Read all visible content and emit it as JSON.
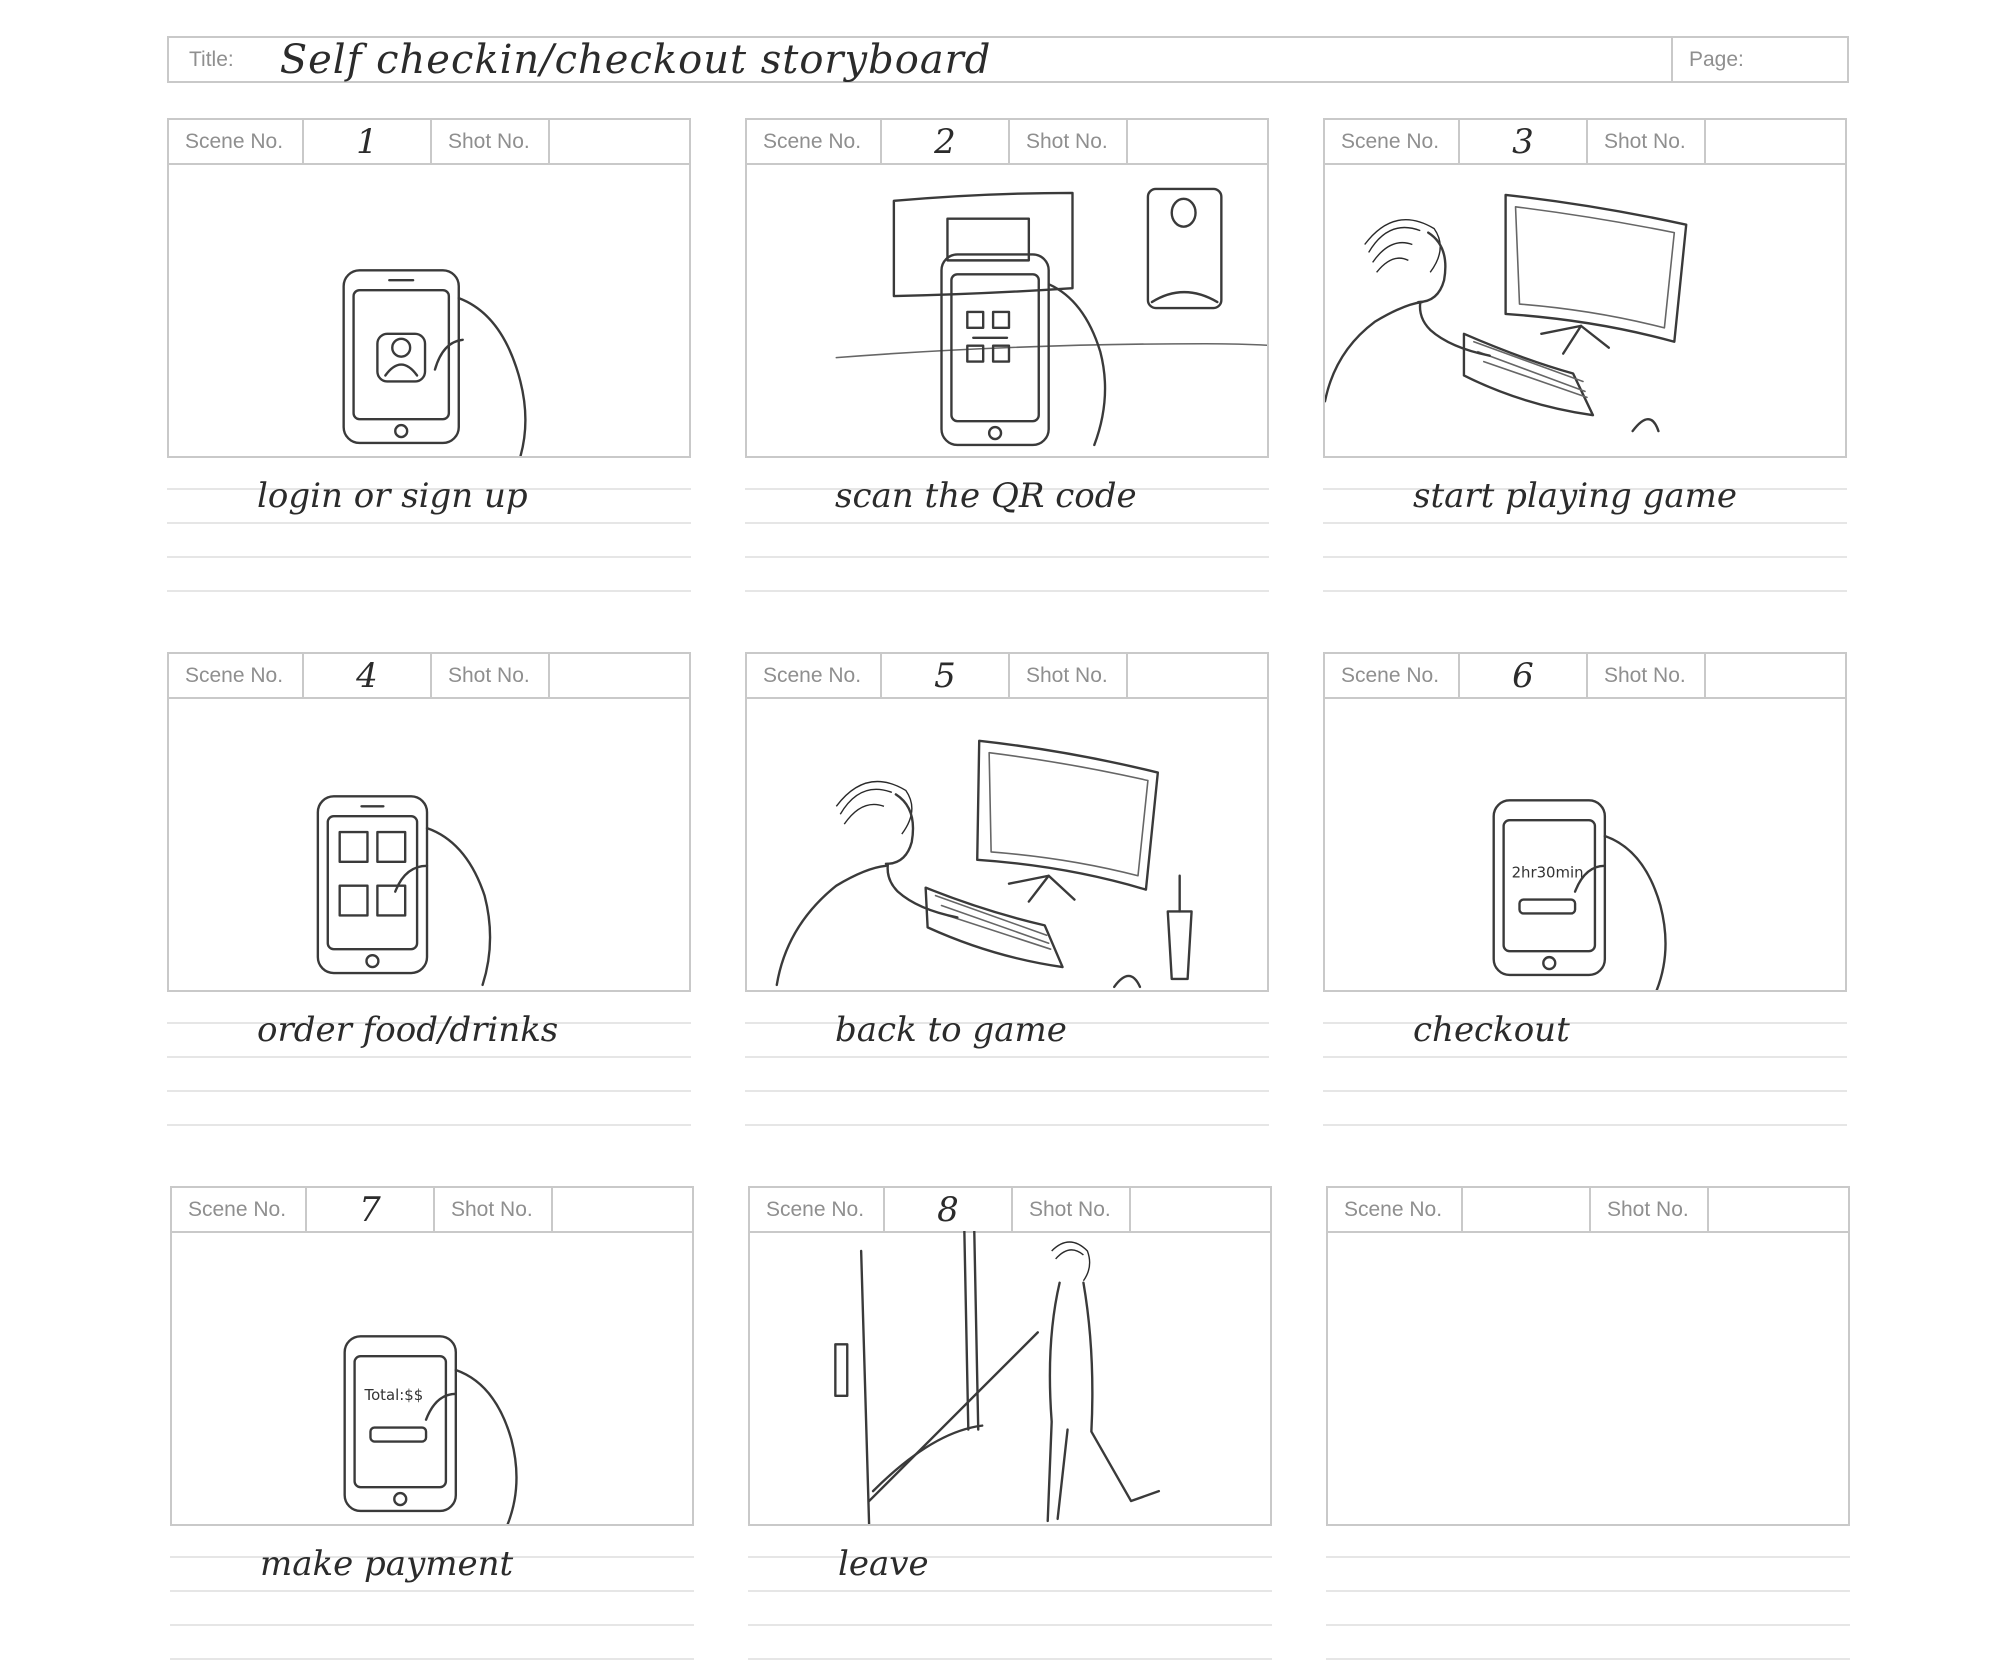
{
  "header": {
    "title_label": "Title:",
    "title_value": "Self checkin/checkout storyboard",
    "page_label": "Page:",
    "page_value": ""
  },
  "labels": {
    "scene": "Scene No.",
    "shot": "Shot No."
  },
  "panels": [
    {
      "scene": "1",
      "shot": "",
      "caption": "login or sign up"
    },
    {
      "scene": "2",
      "shot": "",
      "caption": "scan the QR code"
    },
    {
      "scene": "3",
      "shot": "",
      "caption": "start playing game"
    },
    {
      "scene": "4",
      "shot": "",
      "caption": "order food/drinks"
    },
    {
      "scene": "5",
      "shot": "",
      "caption": "back to game"
    },
    {
      "scene": "6",
      "shot": "",
      "caption": "checkout",
      "screen_text": "2hr30min"
    },
    {
      "scene": "7",
      "shot": "",
      "caption": "make payment",
      "screen_text": "Total:$$"
    },
    {
      "scene": "8",
      "shot": "",
      "caption": "leave"
    },
    {
      "scene": "",
      "shot": "",
      "caption": ""
    }
  ]
}
